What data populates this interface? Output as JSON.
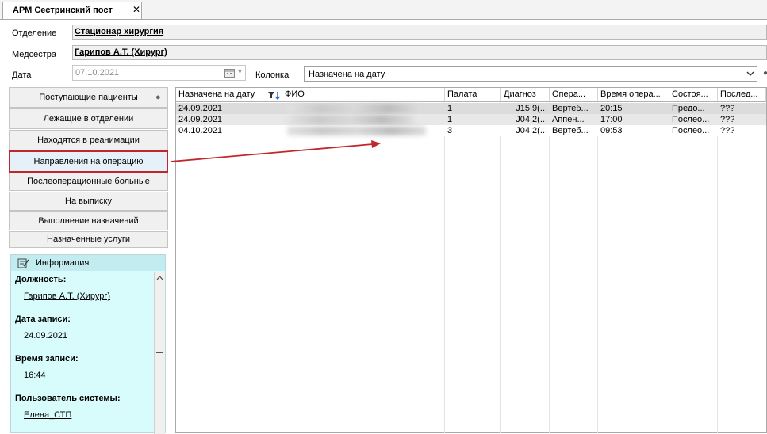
{
  "tab": {
    "title": "АРМ Сестринский пост",
    "close": "✕"
  },
  "form": {
    "department_label": "Отделение",
    "department_value": "Стационар хирургия",
    "nurse_label": "Медсестра",
    "nurse_value": "Гарипов А.Т. (Хирург)",
    "date_label": "Дата",
    "date_value": "07.10.2021",
    "column_label": "Колонка",
    "column_value": "Назначена на дату"
  },
  "nav": [
    "Поступающие пациенты",
    "Лежащие в отделении",
    "Находятся в реанимации",
    "Направления на операцию",
    "Послеоперационные больные",
    "На выписку",
    "Выполнение назначений",
    "Назначенные услуги"
  ],
  "info": {
    "title": "Информация",
    "position_label": "Должность:",
    "position_value": "Гарипов А.Т. (Хирург)",
    "record_date_label": "Дата записи:",
    "record_date_value": "24.09.2021",
    "record_time_label": "Время записи:",
    "record_time_value": "16:44",
    "user_label": "Пользователь системы:",
    "user_value": "Елена_СТП"
  },
  "grid": {
    "headers": [
      "Назначена на дату",
      "ФИО",
      "Палата",
      "Диагноз",
      "Опера...",
      "Время опера...",
      "Состоя...",
      "Послед..."
    ],
    "rows": [
      [
        "24.09.2021",
        "",
        "1",
        "J15.9(...",
        "Вертеб...",
        "20:15",
        "Предо...",
        "???"
      ],
      [
        "24.09.2021",
        "",
        "1",
        "J04.2(...",
        "Аппен...",
        "17:00",
        "Послео...",
        "???"
      ],
      [
        "04.10.2021",
        "",
        "3",
        "J04.2(...",
        "Вертеб...",
        "09:53",
        "Послео...",
        "???"
      ]
    ]
  },
  "colors": {
    "highlight_border": "#c0272d",
    "arrow": "#c0272d",
    "info_bg": "#d8fbfb"
  }
}
